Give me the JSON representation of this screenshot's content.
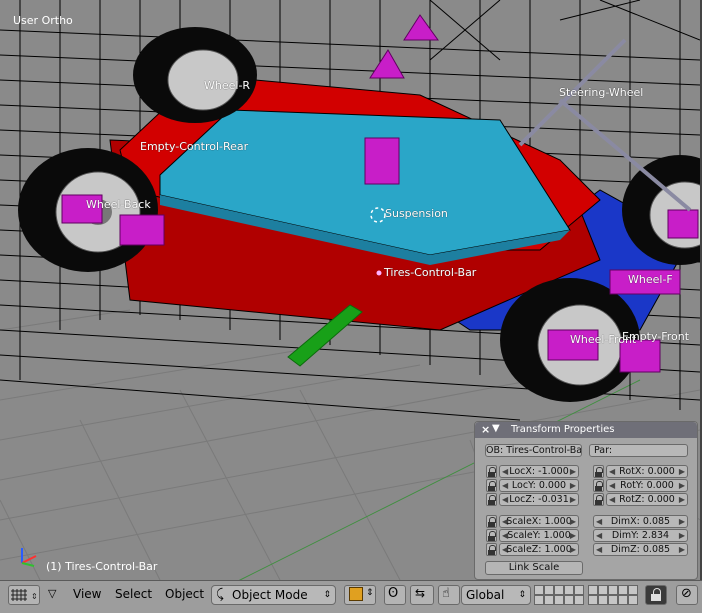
{
  "viewport": {
    "view_label": "User Ortho",
    "active_object_status": "(1) Tires-Control-Bar",
    "object_labels": {
      "steering_wheel": "Steering-Wheel",
      "empty_control_rear": "Empty-Control-Rear",
      "suspension": "Suspension",
      "tires_control_bar": "Tires-Control-Bar",
      "wheel_rear": "Wheel-R",
      "wheel_back": "Wheel-Back",
      "wheel_front": "Wheel-Front",
      "empty_front": "Empty-Front",
      "wheel_side": "Wheel-F"
    },
    "colors": {
      "chassis": "#c80000",
      "deck": "#2aa6c8",
      "wheels": "#0a0a0a",
      "rims": "#cfcfcf",
      "markers": "#c81ec8",
      "floor": "#1a37c8",
      "axis_green": "#18a018"
    }
  },
  "transform_panel": {
    "title": "Transform Properties",
    "object_name": "OB: Tires-Control-Bar",
    "parent": "Par:",
    "loc": [
      {
        "label": "LocX:",
        "value": "-1.000"
      },
      {
        "label": "LocY:",
        "value": "0.000"
      },
      {
        "label": "LocZ:",
        "value": "-0.031"
      }
    ],
    "rot": [
      {
        "label": "RotX:",
        "value": "0.000"
      },
      {
        "label": "RotY:",
        "value": "0.000"
      },
      {
        "label": "RotZ:",
        "value": "0.000"
      }
    ],
    "scale": [
      {
        "label": "ScaleX:",
        "value": "1.000"
      },
      {
        "label": "ScaleY:",
        "value": "1.000"
      },
      {
        "label": "ScaleZ:",
        "value": "1.000"
      }
    ],
    "dim": [
      {
        "label": "DimX:",
        "value": "0.085"
      },
      {
        "label": "DimY:",
        "value": "2.834"
      },
      {
        "label": "DimZ:",
        "value": "0.085"
      }
    ],
    "link_scale": "Link Scale"
  },
  "header": {
    "menus": {
      "view": "View",
      "select": "Select",
      "object": "Object"
    },
    "mode": "Object Mode",
    "orientation": "Global"
  }
}
